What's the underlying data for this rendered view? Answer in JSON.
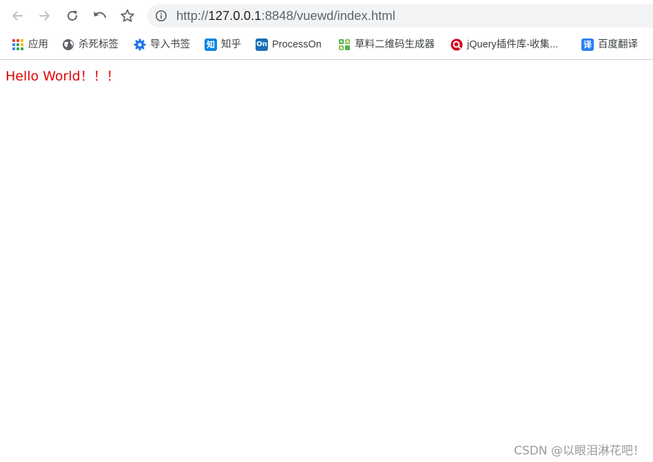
{
  "toolbar": {
    "back_icon": "arrow-left-icon",
    "forward_icon": "arrow-right-icon",
    "reload_icon": "reload-icon",
    "undo_icon": "undo-icon",
    "bookmark_icon": "star-icon",
    "info_icon": "info-icon",
    "url_scheme": "http://",
    "url_host": "127.0.0.1",
    "url_rest": ":8848/vuewd/index.html"
  },
  "bookmarks": [
    {
      "label": "应用",
      "icon": "apps-grid-icon"
    },
    {
      "label": "杀死标签",
      "icon": "globe-icon"
    },
    {
      "label": "导入书签",
      "icon": "gear-icon"
    },
    {
      "label": "知乎",
      "icon": "zhihu-icon",
      "icon_text": "知",
      "color": "#0a84e0"
    },
    {
      "label": "ProcessOn",
      "icon": "processon-icon",
      "icon_text": "On",
      "color": "#1a6fb5"
    },
    {
      "label": "草料二维码生成器",
      "icon": "qrcode-icon",
      "color": "#4caf50"
    },
    {
      "label": "jQuery插件库-收集...",
      "icon": "jquery-icon",
      "color": "#d0021b"
    },
    {
      "label": "百度翻译",
      "icon": "baidu-translate-icon",
      "icon_text": "译",
      "color": "#2a7ff3"
    }
  ],
  "page": {
    "text": "Hello World！！！",
    "text_color": "#e00000"
  },
  "watermark": {
    "text": "CSDN @以眼泪淋花吧！"
  }
}
